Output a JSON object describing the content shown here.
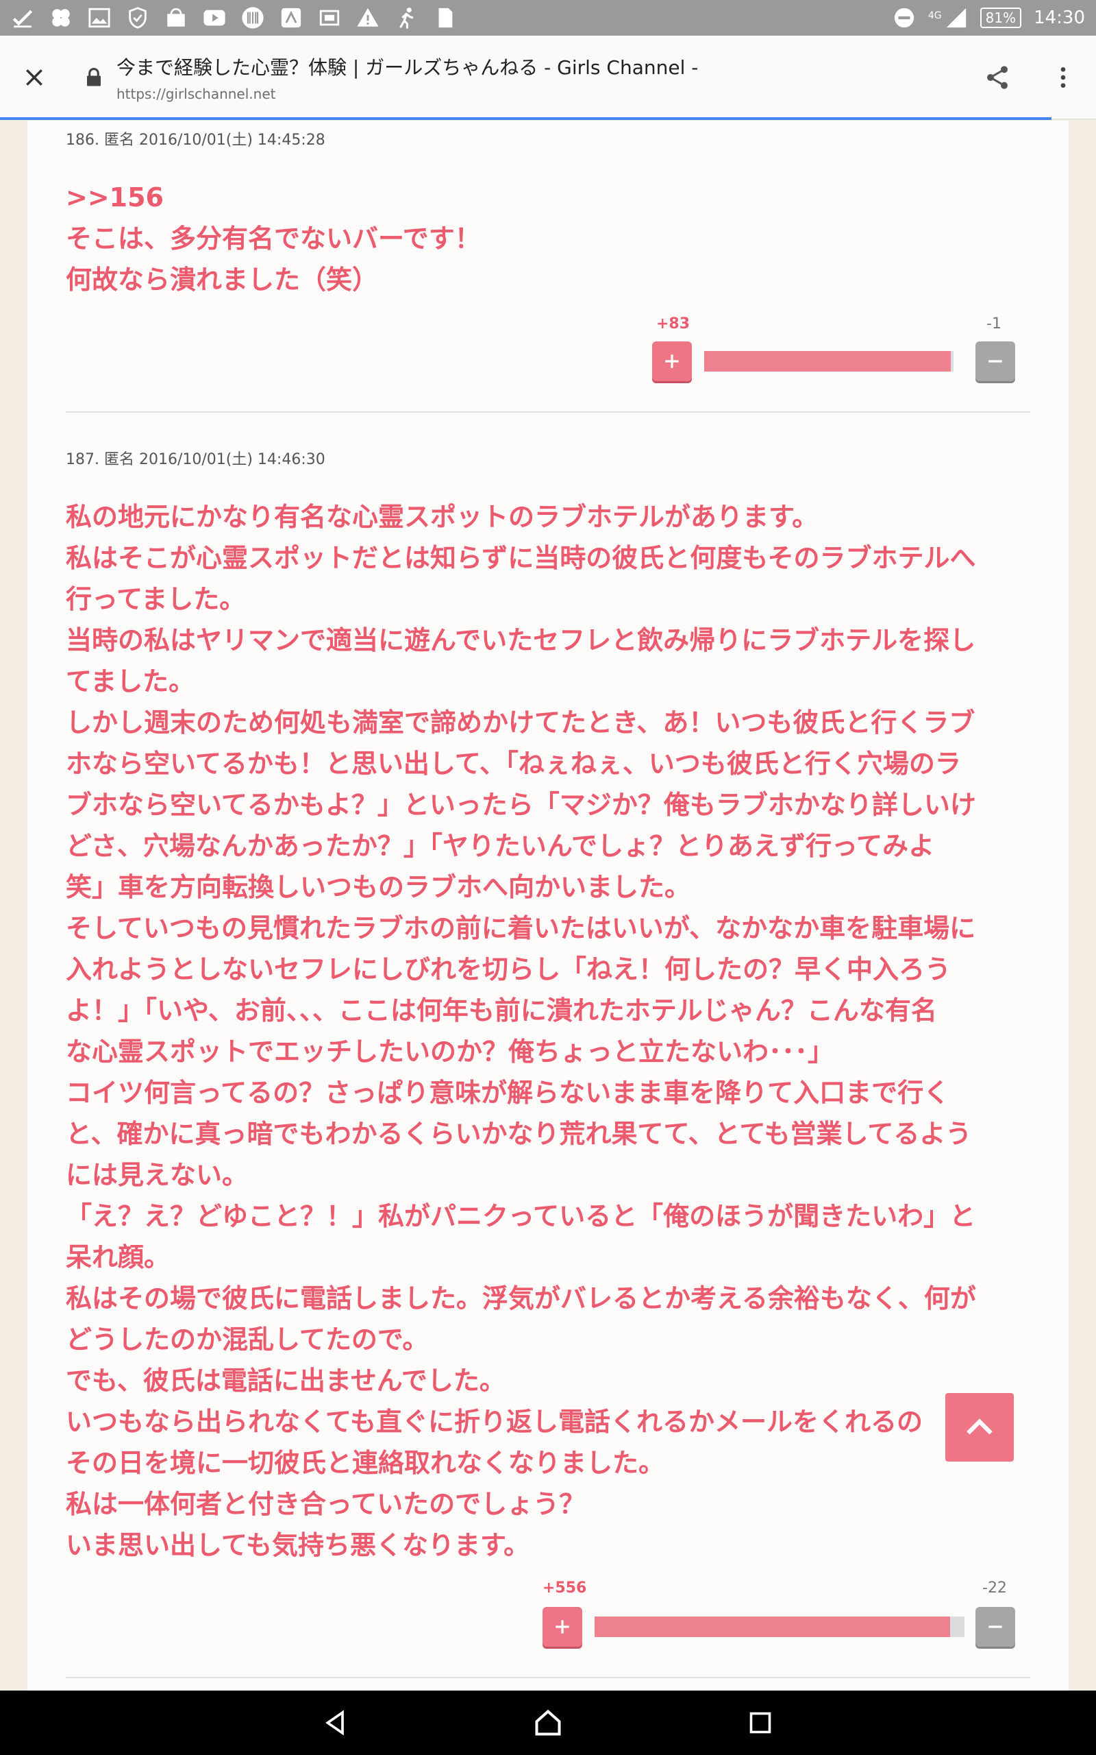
{
  "status_bar": {
    "network": "4G",
    "battery": "81%",
    "time": "14:30"
  },
  "browser": {
    "page_title": "今まで経験した心霊？体験 | ガールズちゃんねる - Girls Channel -",
    "url": "https://girlschannel.net"
  },
  "comments": [
    {
      "meta": "186. 匿名 2016/10/01(土) 14:45:28",
      "anchor": ">>156",
      "lines": [
        "そこは、多分有名でないバーです！",
        "何故なら潰れました（笑）"
      ],
      "plus_count": "+83",
      "minus_count": "-1",
      "plus_label": "+",
      "minus_label": "−",
      "plus_ratio": 0.988
    },
    {
      "meta": "187. 匿名 2016/10/01(土) 14:46:30",
      "lines": [
        "私の地元にかなり有名な心霊スポットのラブホテルがあります。",
        "私はそこが心霊スポットだとは知らずに当時の彼氏と何度もそのラブホテルへ",
        "行ってました。",
        "当時の私はヤリマンで適当に遊んでいたセフレと飲み帰りにラブホテルを探し",
        "てました。",
        "しかし週末のため何処も満室で諦めかけてたとき、あ！いつも彼氏と行くラブ",
        "ホなら空いてるかも！と思い出して、「ねぇねぇ、いつも彼氏と行く穴場のラ",
        "ブホなら空いてるかもよ？」といったら「マジか？俺もラブホかなり詳しいけ",
        "どさ、穴場なんかあったか？」「ヤりたいんでしょ？とりあえず行ってみよ",
        "笑」車を方向転換しいつものラブホへ向かいました。",
        "そしていつもの見慣れたラブホの前に着いたはいいが、なかなか車を駐車場に",
        "入れようとしないセフレにしびれを切らし「ねえ！何したの？早く中入ろう",
        "よ！」「いや、お前、、、ここは何年も前に潰れたホテルじゃん？こんな有名",
        "な心霊スポットでエッチしたいのか？俺ちょっと立たないわ･･･」",
        "コイツ何言ってるの？さっぱり意味が解らないまま車を降りて入口まで行く",
        "と、確かに真っ暗でもわかるくらいかなり荒れ果てて、とても営業してるよう",
        "には見えない。",
        "「え？え？どゆこと？！」私がパニクっていると「俺のほうが聞きたいわ」と",
        "呆れ顔。",
        "私はその場で彼氏に電話しました。浮気がバレるとか考える余裕もなく、何が",
        "どうしたのか混乱してたので。",
        "でも、彼氏は電話に出ませんでした。",
        "いつもなら出られなくても直ぐに折り返し電話くれるかメールをくれるの",
        "その日を境に一切彼氏と連絡取れなくなりました。",
        "私は一体何者と付き合っていたのでしょう？",
        "いま思い出しても気持ち悪くなります。"
      ],
      "plus_count": "+556",
      "minus_count": "-22",
      "plus_label": "+",
      "minus_label": "−",
      "plus_ratio": 0.962
    }
  ],
  "colors": {
    "accent": "#ec5a6e",
    "plus_button": "#ee7585",
    "minus_button": "#a6a6a6",
    "progress": "#4285f4"
  },
  "icons": {
    "close": "close-icon",
    "lock": "lock-icon",
    "share": "share-icon",
    "menu": "more-vert-icon",
    "scroll_top": "chevron-up-icon",
    "nav_back": "back-triangle-icon",
    "nav_home": "home-icon",
    "nav_recents": "recents-square-icon"
  }
}
